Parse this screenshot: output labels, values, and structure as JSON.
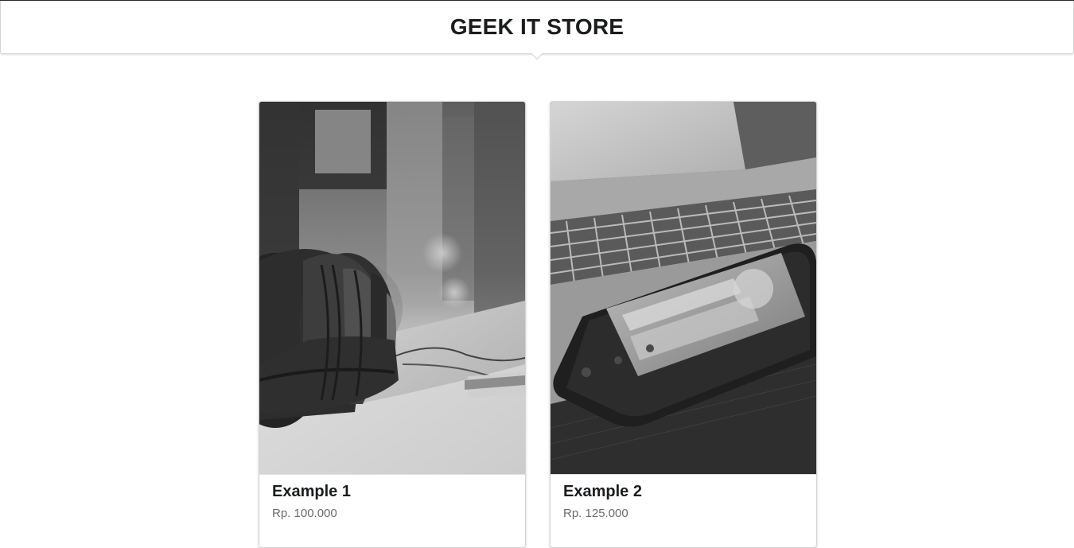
{
  "header": {
    "title": "GEEK IT STORE"
  },
  "products": [
    {
      "name": "Example 1",
      "price": "Rp. 100.000",
      "image": "headphones-photo"
    },
    {
      "name": "Example 2",
      "price": "Rp. 125.000",
      "image": "smartphone-laptop-photo"
    }
  ],
  "colors": {
    "text": "#1b1c1d",
    "price": "#6b6b6b",
    "border": "#d4d4d5"
  }
}
